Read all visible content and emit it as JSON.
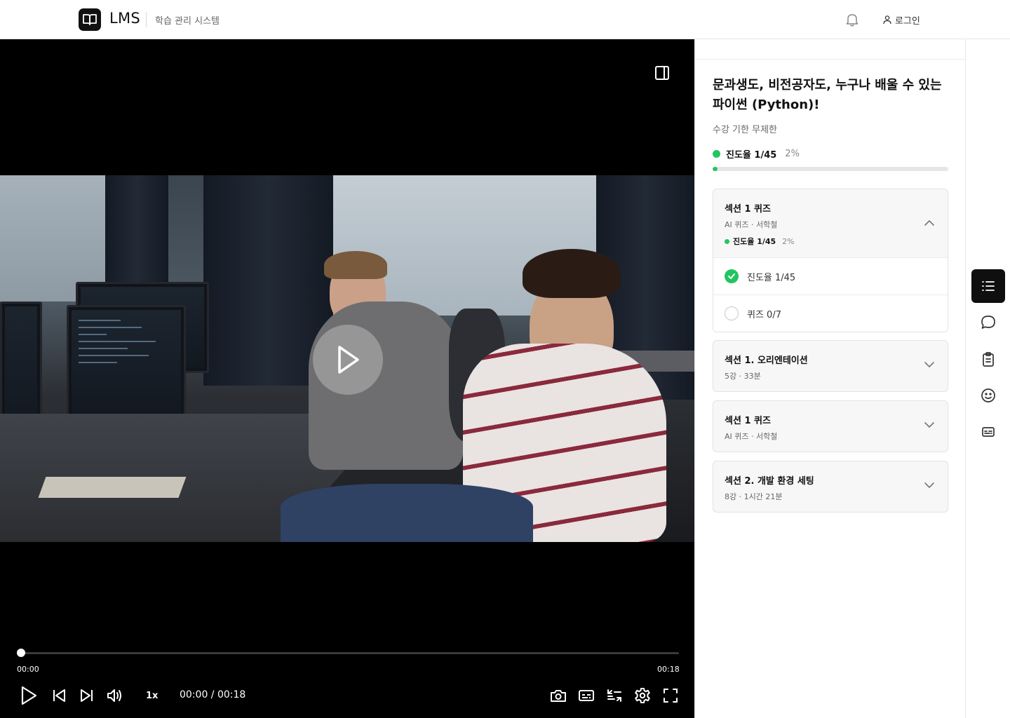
{
  "header": {
    "logo_text": "LMS",
    "subtitle": "학습 관리 시스템",
    "login_label": "로그인"
  },
  "player": {
    "time_current": "00:00",
    "time_total": "00:18",
    "time_display": "00:00 / 00:18",
    "speed": "1x",
    "progress": 0
  },
  "course": {
    "title": "문과생도, 비전공자도, 누구나 배울 수 있는 파이썬 (Python)!",
    "term": "수강 기한 무제한",
    "progress_label": "진도율 1/45",
    "progress_pct": "2%",
    "progress_value": 0.02
  },
  "sections": [
    {
      "title": "섹션 1 퀴즈",
      "sub": "AI 퀴즈 · 서학철",
      "progress_label": "진도율 1/45",
      "progress_pct": "2%",
      "expanded": true,
      "items": [
        {
          "label": "진도율 1/45",
          "done": true
        },
        {
          "label": "퀴즈 0/7",
          "done": false
        }
      ]
    },
    {
      "title": "섹션 1. 오리엔테이션",
      "sub": "5강 · 33분",
      "expanded": false
    },
    {
      "title": "섹션 1 퀴즈",
      "sub": "AI 퀴즈 · 서학철",
      "expanded": false
    },
    {
      "title": "섹션 2. 개발 환경 세팅",
      "sub": "8강 · 1시간 21분",
      "expanded": false
    }
  ],
  "icons": {
    "rail": [
      "list-icon",
      "chat-icon",
      "clipboard-icon",
      "smile-icon",
      "subtitles-icon"
    ],
    "controls_left": [
      "play-icon",
      "skip-back-icon",
      "skip-forward-icon",
      "volume-icon"
    ],
    "controls_right": [
      "camera-icon",
      "subtitles-icon",
      "swap-icon",
      "settings-icon",
      "fullscreen-icon"
    ]
  },
  "colors": {
    "accent": "#22c55e",
    "rail_active": "#0f0f0f"
  }
}
